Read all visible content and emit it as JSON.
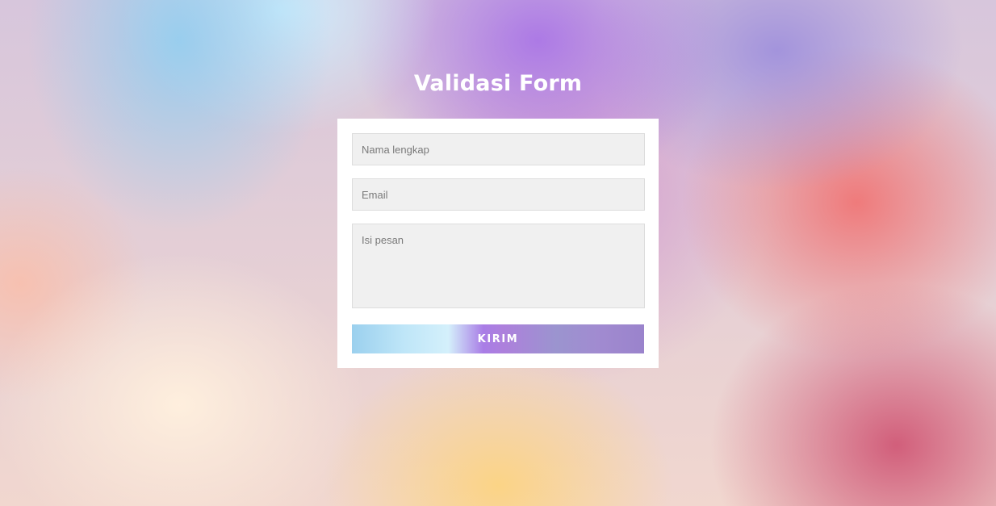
{
  "page": {
    "title": "Validasi Form"
  },
  "form": {
    "name_placeholder": "Nama lengkap",
    "email_placeholder": "Email",
    "message_placeholder": "Isi pesan",
    "submit_label": "KIRIM"
  },
  "colors": {
    "card_background": "#ffffff",
    "field_background": "#f0f0f0",
    "title_text": "#ffffff"
  }
}
